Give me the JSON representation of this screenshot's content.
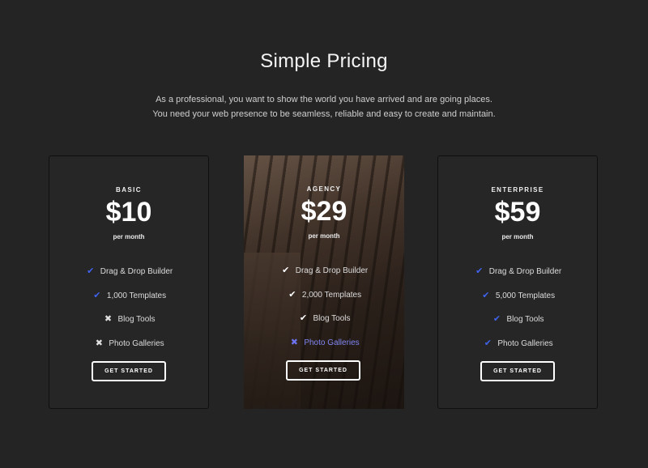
{
  "header": {
    "title": "Simple Pricing",
    "subtitle_line1": "As a professional, you want to show the world you have arrived and are going places.",
    "subtitle_line2": "You need your web presence to be seamless, reliable and easy to create and maintain."
  },
  "colors": {
    "background": "#242424",
    "check_blue": "#3f63ee",
    "muted_purple": "#7f86f2"
  },
  "plans": [
    {
      "name": "BASIC",
      "price": "$10",
      "period": "per month",
      "features": [
        {
          "label": "Drag & Drop Builder",
          "icon": "check-icon"
        },
        {
          "label": "1,000 Templates",
          "icon": "check-icon"
        },
        {
          "label": "Blog Tools",
          "icon": "cross-icon"
        },
        {
          "label": "Photo Galleries",
          "icon": "cross-icon"
        }
      ],
      "cta": "GET STARTED"
    },
    {
      "name": "AGENCY",
      "price": "$29",
      "period": "per month",
      "features": [
        {
          "label": "Drag & Drop Builder",
          "icon": "check-icon"
        },
        {
          "label": "2,000 Templates",
          "icon": "check-icon"
        },
        {
          "label": "Blog Tools",
          "icon": "check-icon"
        },
        {
          "label": "Photo Galleries",
          "icon": "cross-icon"
        }
      ],
      "cta": "GET STARTED"
    },
    {
      "name": "ENTERPRISE",
      "price": "$59",
      "period": "per month",
      "features": [
        {
          "label": "Drag & Drop Builder",
          "icon": "check-icon"
        },
        {
          "label": "5,000 Templates",
          "icon": "check-icon"
        },
        {
          "label": "Blog Tools",
          "icon": "check-icon"
        },
        {
          "label": "Photo Galleries",
          "icon": "check-icon"
        }
      ],
      "cta": "GET STARTED"
    }
  ]
}
